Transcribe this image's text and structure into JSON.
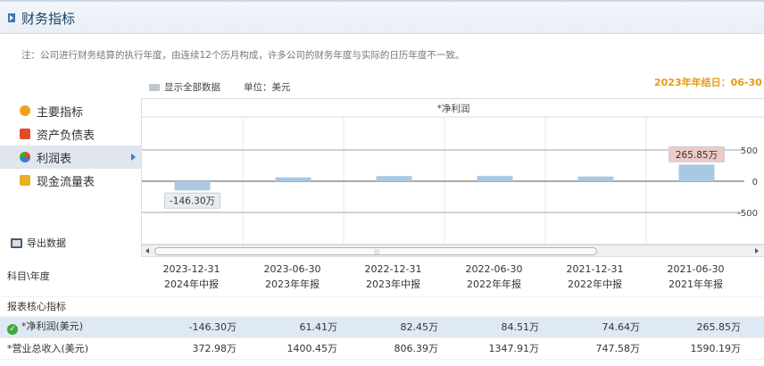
{
  "header": {
    "title": "财务指标"
  },
  "note": "注：公司进行财务结算的执行年度，由连续12个历月构成，许多公司的财务年度与实际的日历年度不一致。",
  "toolbar": {
    "show_all": "显示全部数据",
    "unit": "单位：美元",
    "fiscal_year_end": "2023年年结日：06-30"
  },
  "sidebar": {
    "items": [
      {
        "label": "主要指标",
        "icon": "flower-icon",
        "color": "#f0a020"
      },
      {
        "label": "资产负债表",
        "icon": "document-icon",
        "color": "#e04b2a"
      },
      {
        "label": "利润表",
        "icon": "pie-icon",
        "color": "#3f7ad0"
      },
      {
        "label": "现金流量表",
        "icon": "cash-icon",
        "color": "#e8b020"
      }
    ],
    "active_index": 2,
    "export": "导出数据"
  },
  "chart_data": {
    "type": "bar",
    "title": "*净利润",
    "categories": [
      "2023-12-31",
      "2023-06-30",
      "2022-12-31",
      "2022-06-30",
      "2021-12-31",
      "2021-06-30"
    ],
    "values": [
      -146.3,
      61.41,
      82.45,
      84.51,
      74.64,
      265.85
    ],
    "value_unit": "万",
    "labels": [
      {
        "index": 0,
        "text": "-146.30万"
      },
      {
        "index": 5,
        "text": "265.85万"
      }
    ],
    "yticks": [
      500,
      0,
      -500
    ],
    "ylim": [
      -760,
      760
    ],
    "bar_color": "#a9c8e4"
  },
  "table": {
    "corner": "科目\\年度",
    "columns": [
      {
        "date": "2023-12-31",
        "period": "2024年中报"
      },
      {
        "date": "2023-06-30",
        "period": "2023年年报"
      },
      {
        "date": "2022-12-31",
        "period": "2023年中报"
      },
      {
        "date": "2022-06-30",
        "period": "2022年年报"
      },
      {
        "date": "2021-12-31",
        "period": "2022年中报"
      },
      {
        "date": "2021-06-30",
        "period": "2021年年报"
      }
    ],
    "section": "报表核心指标",
    "rows": [
      {
        "label": "*净利润(美元)",
        "values": [
          "-146.30万",
          "61.41万",
          "82.45万",
          "84.51万",
          "74.64万",
          "265.85万"
        ]
      },
      {
        "label": "*营业总收入(美元)",
        "values": [
          "372.98万",
          "1400.45万",
          "806.39万",
          "1347.91万",
          "747.58万",
          "1590.19万"
        ]
      }
    ]
  }
}
